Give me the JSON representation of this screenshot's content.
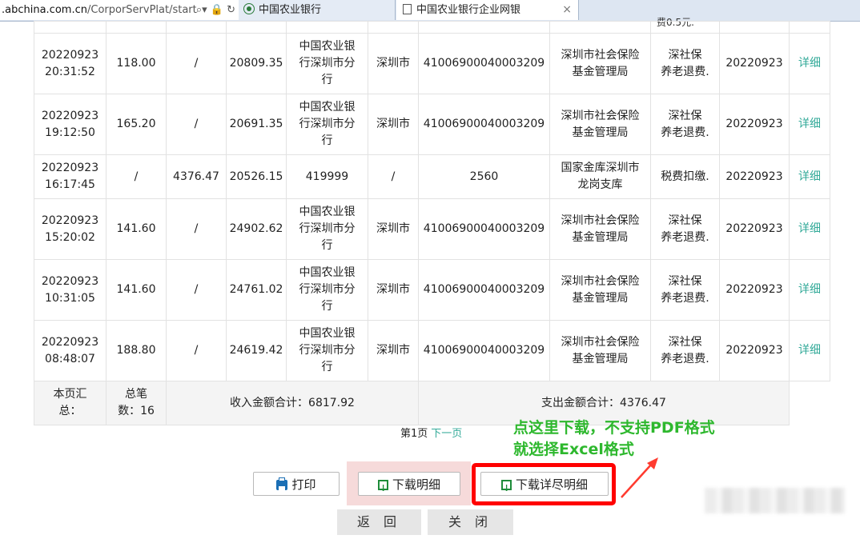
{
  "browser": {
    "url_main": ".abchina.com.cn",
    "url_rest": "/CorporServPlat/start",
    "addr_icons": "⌕▾ 🔒 ↻",
    "tabs": [
      {
        "label": "中国农业银行"
      },
      {
        "label": "中国农业银行企业网银",
        "close": "×"
      }
    ]
  },
  "cutoff_text": "费0.5元.",
  "rows": [
    {
      "time_date": "20220923",
      "time_clock": "20:31:52",
      "income": "118.00",
      "expense": "/",
      "balance": "20809.35",
      "bank_lines": [
        "中国农业银",
        "行深圳市分",
        "行"
      ],
      "city": "深圳市",
      "account": "41006900040003209",
      "party_lines": [
        "深圳市社会保险",
        "基金管理局"
      ],
      "memo_lines": [
        "深社保",
        "养老退费."
      ],
      "date": "20220923",
      "action": "详细"
    },
    {
      "time_date": "20220923",
      "time_clock": "19:12:50",
      "income": "165.20",
      "expense": "/",
      "balance": "20691.35",
      "bank_lines": [
        "中国农业银",
        "行深圳市分",
        "行"
      ],
      "city": "深圳市",
      "account": "41006900040003209",
      "party_lines": [
        "深圳市社会保险",
        "基金管理局"
      ],
      "memo_lines": [
        "深社保",
        "养老退费."
      ],
      "date": "20220923",
      "action": "详细"
    },
    {
      "time_date": "20220923",
      "time_clock": "16:17:45",
      "income": "/",
      "expense": "4376.47",
      "balance": "20526.15",
      "bank_lines": [
        "419999"
      ],
      "city": "/",
      "account": "2560",
      "party_lines": [
        "国家金库深圳市",
        "龙岗支库"
      ],
      "memo_lines": [
        "税费扣缴."
      ],
      "date": "20220923",
      "action": "详细"
    },
    {
      "time_date": "20220923",
      "time_clock": "15:20:02",
      "income": "141.60",
      "expense": "/",
      "balance": "24902.62",
      "bank_lines": [
        "中国农业银",
        "行深圳市分",
        "行"
      ],
      "city": "深圳市",
      "account": "41006900040003209",
      "party_lines": [
        "深圳市社会保险",
        "基金管理局"
      ],
      "memo_lines": [
        "深社保",
        "养老退费."
      ],
      "date": "20220923",
      "action": "详细"
    },
    {
      "time_date": "20220923",
      "time_clock": "10:31:05",
      "income": "141.60",
      "expense": "/",
      "balance": "24761.02",
      "bank_lines": [
        "中国农业银",
        "行深圳市分",
        "行"
      ],
      "city": "深圳市",
      "account": "41006900040003209",
      "party_lines": [
        "深圳市社会保险",
        "基金管理局"
      ],
      "memo_lines": [
        "深社保",
        "养老退费."
      ],
      "date": "20220923",
      "action": "详细"
    },
    {
      "time_date": "20220923",
      "time_clock": "08:48:07",
      "income": "188.80",
      "expense": "/",
      "balance": "24619.42",
      "bank_lines": [
        "中国农业银",
        "行深圳市分",
        "行"
      ],
      "city": "深圳市",
      "account": "41006900040003209",
      "party_lines": [
        "深圳市社会保险",
        "基金管理局"
      ],
      "memo_lines": [
        "深社保",
        "养老退费."
      ],
      "date": "20220923",
      "action": "详细"
    }
  ],
  "summary": {
    "label_line1": "本页汇",
    "label_line2": "总：",
    "count_line1": "总笔",
    "count_line2": "数：16",
    "income_total": "收入金额合计：6817.92",
    "expense_total": "支出金额合计：4376.47"
  },
  "pager": {
    "current": "第1页",
    "next": "下一页"
  },
  "annotation": {
    "line1": "点这里下载，不支持PDF格式",
    "line2": "就选择Excel格式",
    "color": "#2eb82e"
  },
  "buttons": {
    "print": "打印",
    "download_detail": "下载明细",
    "download_full_detail": "下载详尽明细",
    "back": "返 回",
    "close": "关 闭"
  },
  "colors": {
    "link": "#33aa99",
    "highlight_border": "#ff0000"
  }
}
